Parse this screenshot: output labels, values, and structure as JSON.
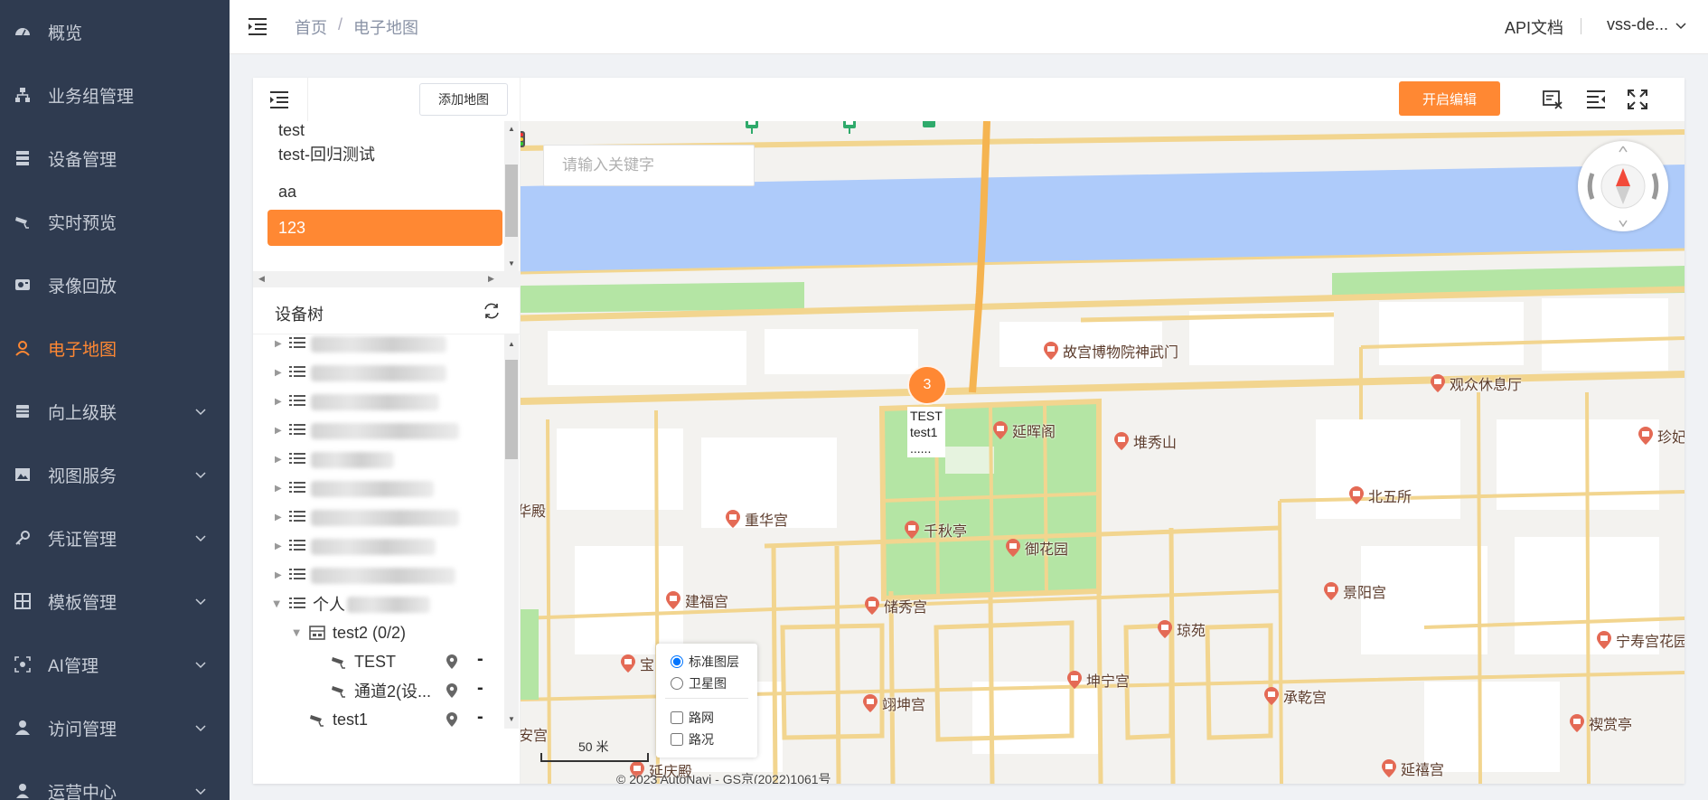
{
  "sidebar": {
    "items": [
      {
        "label": "概览",
        "icon": "dashboard-icon",
        "expandable": false
      },
      {
        "label": "业务组管理",
        "icon": "org-icon",
        "expandable": false
      },
      {
        "label": "设备管理",
        "icon": "server-icon",
        "expandable": false
      },
      {
        "label": "实时预览",
        "icon": "camera-icon",
        "expandable": false
      },
      {
        "label": "录像回放",
        "icon": "playback-icon",
        "expandable": false
      },
      {
        "label": "电子地图",
        "icon": "map-user-icon",
        "expandable": false,
        "active": true
      },
      {
        "label": "向上级联",
        "icon": "cascade-icon",
        "expandable": true
      },
      {
        "label": "视图服务",
        "icon": "image-icon",
        "expandable": true
      },
      {
        "label": "凭证管理",
        "icon": "key-icon",
        "expandable": true
      },
      {
        "label": "模板管理",
        "icon": "grid-icon",
        "expandable": true
      },
      {
        "label": "AI管理",
        "icon": "ai-icon",
        "expandable": true
      },
      {
        "label": "访问管理",
        "icon": "user-icon",
        "expandable": true
      },
      {
        "label": "运营中心",
        "icon": "person-icon",
        "expandable": true
      }
    ],
    "colors": {
      "bg": "#2f3b50",
      "text": "#c8ced8",
      "active": "#ff8833"
    }
  },
  "header": {
    "breadcrumb": [
      "首页",
      "电子地图"
    ],
    "breadcrumb_sep": "/",
    "api_doc": "API文档",
    "user": "vss-de..."
  },
  "left_panel": {
    "add_map_label": "添加地图",
    "maps": [
      "test",
      "test-回归测试",
      "aa",
      "123"
    ],
    "selected_map": "123",
    "tree_title": "设备树",
    "tree": {
      "personal_label": "个人",
      "group": "test2 (0/2)",
      "channels": [
        "TEST",
        "通道2(设..."
      ],
      "device": "test1",
      "dash": "-"
    }
  },
  "map": {
    "edit_label": "开启编辑",
    "search_placeholder": "请输入关键字",
    "cluster": {
      "count": "3",
      "labels": [
        "TEST",
        "test1",
        "......"
      ]
    },
    "pois": [
      "故宫博物院神武门",
      "观众休息厅",
      "延晖阁",
      "堆秀山",
      "珍妃",
      "北五所",
      "重华宫",
      "千秋亭",
      "御花园",
      "华殿",
      "建福宫",
      "储秀宫",
      "景阳宫",
      "琼苑",
      "宁寿宫花园",
      "宝",
      "坤宁宫",
      "承乾宫",
      "翊坤宫",
      "禊赏亭",
      "安宫",
      "延禧宫",
      "延庆殿"
    ],
    "layers": {
      "standard": "标准图层",
      "satellite": "卫星图",
      "road": "路网",
      "traffic": "路况",
      "selected": "standard"
    },
    "scale": "50 米",
    "copyright": "© 2023 AutoNavi - GS京(2022)1061号",
    "colors": {
      "water": "#aecbfa",
      "green": "#b4e5a4",
      "road": "#f2d58f",
      "block": "#ffffff",
      "accent": "#ff8833"
    }
  }
}
